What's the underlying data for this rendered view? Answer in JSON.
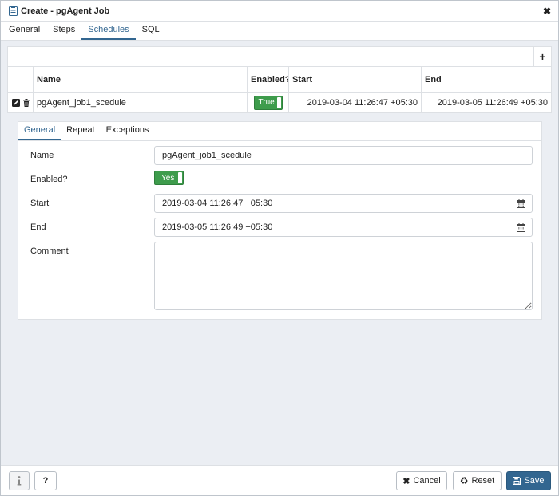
{
  "dialog": {
    "title": "Create - pgAgent Job",
    "close_icon": "close-icon",
    "tabs": [
      {
        "label": "General",
        "active": false
      },
      {
        "label": "Steps",
        "active": false
      },
      {
        "label": "Schedules",
        "active": true
      },
      {
        "label": "SQL",
        "active": false
      }
    ]
  },
  "schedules_grid": {
    "add_icon": "plus-icon",
    "columns": [
      "Name",
      "Enabled?",
      "Start",
      "End"
    ],
    "rows": [
      {
        "name": "pgAgent_job1_scedule",
        "enabled": "True",
        "start": "2019-03-04 11:26:47 +05:30",
        "end": "2019-03-05 11:26:49 +05:30",
        "icons": [
          "edit-icon",
          "trash-icon"
        ]
      }
    ]
  },
  "detail": {
    "tabs": [
      {
        "label": "General",
        "active": true
      },
      {
        "label": "Repeat",
        "active": false
      },
      {
        "label": "Exceptions",
        "active": false
      }
    ],
    "fields": {
      "name_label": "Name",
      "name_value": "pgAgent_job1_scedule",
      "enabled_label": "Enabled?",
      "enabled_value": "Yes",
      "start_label": "Start",
      "start_value": "2019-03-04 11:26:47 +05:30",
      "end_label": "End",
      "end_value": "2019-03-05 11:26:49 +05:30",
      "comment_label": "Comment",
      "comment_value": ""
    }
  },
  "footer": {
    "info_icon": "info-icon",
    "help_label": "?",
    "cancel_label": "Cancel",
    "reset_label": "Reset",
    "save_label": "Save"
  },
  "colors": {
    "accent": "#326690",
    "toggle_on": "#3e9c4c",
    "panel_bg": "#ebeef3"
  }
}
